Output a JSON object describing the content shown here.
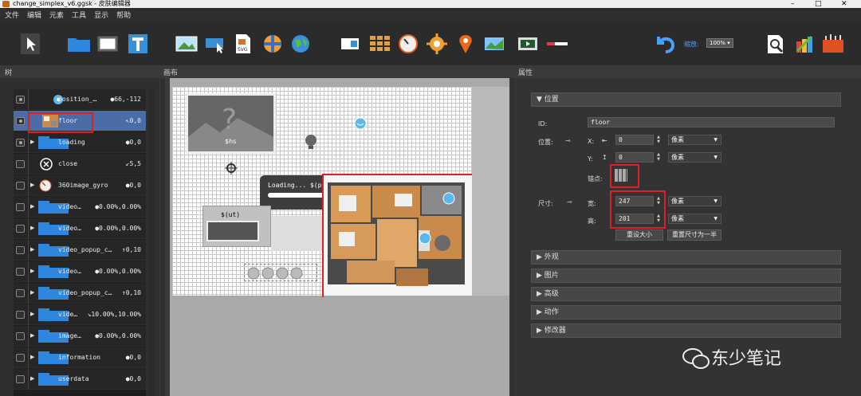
{
  "window": {
    "title": "change_simplex_v6.ggsk - 皮肤编辑器",
    "minimize": "–",
    "maximize": "□",
    "close": "✕"
  },
  "menu": [
    "文件",
    "编辑",
    "元素",
    "工具",
    "显示",
    "帮助"
  ],
  "toolbar": {
    "zoom_label": "缩放:",
    "zoom_value": "100%"
  },
  "panels": {
    "tree_title": "树",
    "canvas_title": "画布",
    "props_title": "属性"
  },
  "tree": [
    {
      "label": "position_…",
      "value": "●66,-112",
      "icon": "position-icon",
      "eye": true
    },
    {
      "label": "floor",
      "value": "↖0,0",
      "icon": "floorplan-thumb-icon",
      "eye": true,
      "selected": true
    },
    {
      "label": "loading",
      "value": "●0,0",
      "icon": "folder-icon",
      "eye": true,
      "expand": true
    },
    {
      "label": "close",
      "value": "↙5,5",
      "icon": "close-circle-icon",
      "eye": false
    },
    {
      "label": "360image_gyro",
      "value": "●0,0",
      "icon": "gyro-icon",
      "eye": false,
      "expand": true
    },
    {
      "label": "video…",
      "value": "●0.00%,0.00%",
      "icon": "folder-icon",
      "eye": false,
      "expand": true
    },
    {
      "label": "video…",
      "value": "●0.00%,0.00%",
      "icon": "folder-icon",
      "eye": false,
      "expand": true
    },
    {
      "label": "video_popup_c…",
      "value": "↑0,10",
      "icon": "folder-icon",
      "eye": false,
      "expand": true
    },
    {
      "label": "video…",
      "value": "●0.00%,0.00%",
      "icon": "folder-icon",
      "eye": false,
      "expand": true
    },
    {
      "label": "video_popup_c…",
      "value": "↑0,10",
      "icon": "folder-icon",
      "eye": false,
      "expand": true
    },
    {
      "label": "vide…",
      "value": "↘10.00%,10.00%",
      "icon": "folder-icon",
      "eye": false,
      "expand": true
    },
    {
      "label": "image…",
      "value": "●0.00%,0.00%",
      "icon": "folder-icon",
      "eye": false,
      "expand": true
    },
    {
      "label": "information",
      "value": "●0,0",
      "icon": "folder-icon",
      "eye": false,
      "expand": true
    },
    {
      "label": "userdata",
      "value": "●0,0",
      "icon": "folder-icon",
      "eye": false,
      "expand": true
    }
  ],
  "canvas": {
    "loading_text": "Loading... $(p)%",
    "ut_text": "$(ut)",
    "hs_text": "$hs"
  },
  "props": {
    "section_position": "▼ 位置",
    "id_label": "ID:",
    "id_value": "floor",
    "pos_label": "位置:",
    "x_label": "X:",
    "x_value": "0",
    "y_label": "Y:",
    "y_value": "0",
    "unit": "像素",
    "anchor_label": "锚点:",
    "size_label": "尺寸:",
    "w_label": "宽:",
    "w_value": "247",
    "h_label": "高:",
    "h_value": "201",
    "reset_size": "重设大小",
    "reset_half": "重置尺寸为一半",
    "collapsed": [
      "▶ 外观",
      "▶ 图片",
      "▶ 高级",
      "▶ 动作",
      "▶ 修改器"
    ]
  },
  "watermark": "东少笔记"
}
